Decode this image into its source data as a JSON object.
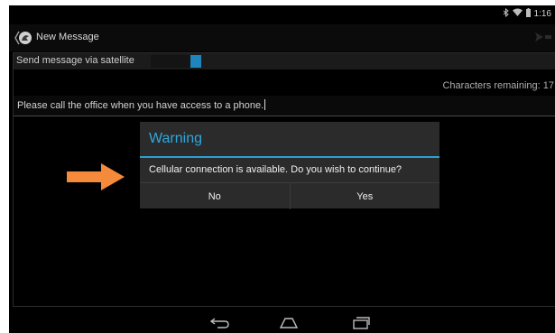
{
  "status_bar": {
    "time": "1:16"
  },
  "action_bar": {
    "title": "New Message"
  },
  "compose": {
    "satellite_label": "Send message via satellite",
    "satellite_enabled": true,
    "characters_remaining": "Characters remaining: 17",
    "message": "Please  call the office when you have access to a phone."
  },
  "dialog": {
    "title": "Warning",
    "message": "Cellular connection is available. Do you wish to continue?",
    "no_label": "No",
    "yes_label": "Yes"
  },
  "colors": {
    "accent": "#2fa8de",
    "toggle_on": "#1e86bc",
    "arrow": "#f58a3a",
    "dialog_bg": "#2b2b2b"
  },
  "icons": [
    "bluetooth-icon",
    "wifi-icon",
    "battery-icon",
    "app-icon",
    "send-icon",
    "back-icon",
    "home-icon",
    "recents-icon",
    "arrow-icon"
  ]
}
